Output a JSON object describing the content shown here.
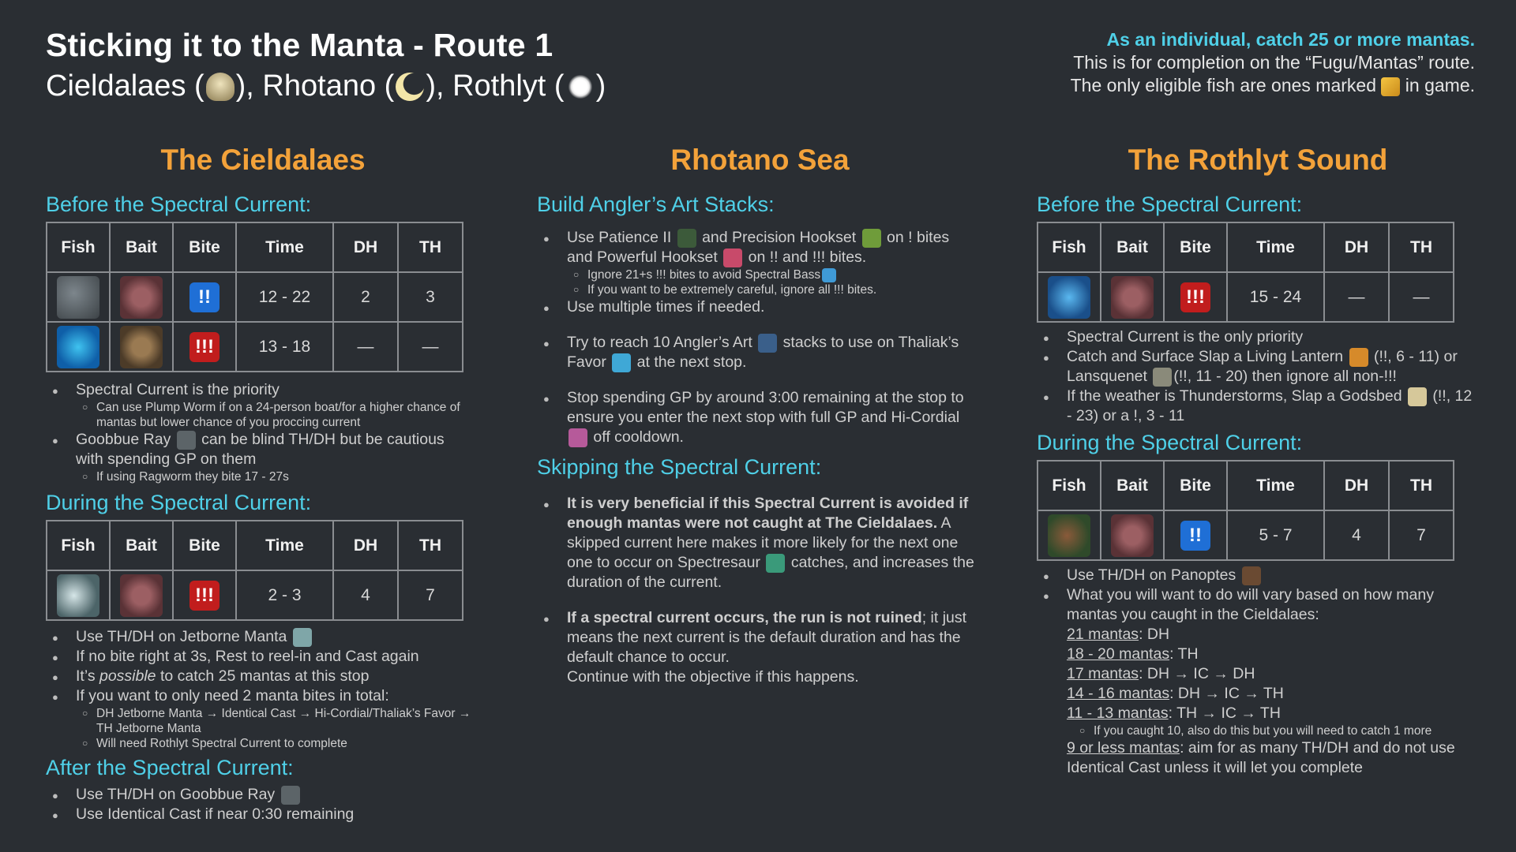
{
  "header": {
    "title": "Sticking it to the Manta - Route 1",
    "subtitle_parts": [
      "Cieldalaes (",
      "), Rhotano (",
      "), Rothlyt (",
      ")"
    ],
    "objective": "As an individual, catch 25 or more mantas.",
    "note1": "This is for completion on the “Fugu/Mantas” route.",
    "note2a": "The only eligible fish are ones marked ",
    "note2b": " in game."
  },
  "col1": {
    "title": "The Cieldalaes",
    "before_head": "Before the Spectral Current:",
    "table_headers": [
      "Fish",
      "Bait",
      "Bite",
      "Time",
      "DH",
      "TH"
    ],
    "before_rows": [
      {
        "bite": "!!",
        "time": "12 - 22",
        "dh": "2",
        "th": "3"
      },
      {
        "bite": "!!!",
        "time": "13 - 18",
        "dh": "—",
        "th": "—"
      }
    ],
    "b1": "Spectral Current is the priority",
    "b1s1": "Can use Plump Worm if on a 24-person boat/for a higher chance of mantas but lower chance of you proccing current",
    "b2a": "Goobbue Ray ",
    "b2b": " can be blind TH/DH but be cautious with spending GP on them",
    "b2s1": "If using Ragworm they bite 17 - 27s",
    "during_head": "During the Spectral Current:",
    "during_rows": [
      {
        "bite": "!!!",
        "time": "2 - 3",
        "dh": "4",
        "th": "7"
      }
    ],
    "d1": "Use TH/DH on Jetborne Manta ",
    "d2": "If no bite right at 3s, Rest to reel-in and Cast again",
    "d3a": "It’s ",
    "d3b": "possible",
    "d3c": " to catch 25 mantas at this stop",
    "d4": "If you want to only need 2 manta bites in total:",
    "d4s1": "DH Jetborne Manta → Identical Cast → Hi-Cordial/Thaliak’s Favor → TH Jetborne Manta",
    "d4s2": "Will need Rothlyt Spectral Current to complete",
    "after_head": "After the Spectral Current:",
    "a1": "Use TH/DH on Goobbue Ray ",
    "a2": "Use Identical Cast if near 0:30 remaining"
  },
  "col2": {
    "title": "Rhotano Sea",
    "build_head": "Build Angler’s Art Stacks:",
    "r1a": "Use Patience II ",
    "r1b": " and Precision Hookset ",
    "r1c": " on ! bites and Powerful Hookset ",
    "r1d": " on !! and !!! bites.",
    "r1s1": "Ignore 21+s !!! bites to avoid Spectral Bass",
    "r1s2": "If you want to be extremely careful, ignore all !!! bites.",
    "r2": "Use multiple times if needed.",
    "r3a": "Try to reach 10 Angler’s Art ",
    "r3b": " stacks to use on Thaliak’s Favor ",
    "r3c": " at the next stop.",
    "r4a": "Stop spending GP by around 3:00 remaining at the stop to ensure you enter the next stop with full GP and Hi-Cordial ",
    "r4b": " off cooldown.",
    "skip_head": "Skipping the Spectral Current:",
    "s1bold": "It is very beneficial if this Spectral Current is avoided if enough mantas were not caught at The Cieldalaes.",
    "s1a": " A skipped current here makes it more likely for the next one one to occur on Spectresaur ",
    "s1b": " catches, and increases the duration of the current.",
    "s2bold": "If a spectral current occurs, the run is not ruined",
    "s2a": "; it just means the next current is the default duration and has the default chance to occur.",
    "s2b": "Continue with the objective if this happens."
  },
  "col3": {
    "title": "The Rothlyt Sound",
    "before_head": "Before the Spectral Current:",
    "before_rows": [
      {
        "bite": "!!!",
        "time": "15 - 24",
        "dh": "—",
        "th": "—"
      }
    ],
    "t1": "Spectral Current is the only priority",
    "t2a": "Catch and Surface Slap a Living Lantern ",
    "t2b": " (!!, 6 - 11) or Lansquenet ",
    "t2c": "(!!, 11 - 20) then ignore all non-!!!",
    "t3a": "If the weather is Thunderstorms, Slap a Godsbed ",
    "t3b": " (!!, 12 - 23) or a !, 3 - 11",
    "during_head": "During the Spectral Current:",
    "during_rows": [
      {
        "bite": "!!",
        "time": "5 - 7",
        "dh": "4",
        "th": "7"
      }
    ],
    "u1": "Use TH/DH on Panoptes ",
    "u2": "What you will want to do will vary based on how many mantas you caught in the Cieldalaes:",
    "m1k": "21 mantas",
    "m1v": ": DH",
    "m2k": "18 - 20 mantas",
    "m2v": ": TH",
    "m3k": "17 mantas",
    "m3v": ": DH → IC → DH",
    "m4k": "14 - 16 mantas",
    "m4v": ": DH → IC → TH",
    "m5k": "11 - 13 mantas",
    "m5v": ": TH → IC → TH",
    "m5s": "If you caught 10, also do this but you will need to catch 1 more",
    "m6k": "9 or less mantas",
    "m6v": ": aim for as many TH/DH and do not use Identical Cast unless it will let you complete"
  },
  "colors": {
    "background": "#2a2e33",
    "accent_cyan": "#4fd0e8",
    "accent_orange": "#f3a23a",
    "bite_blue": "#1f6fd6",
    "bite_red": "#c11d1d"
  }
}
